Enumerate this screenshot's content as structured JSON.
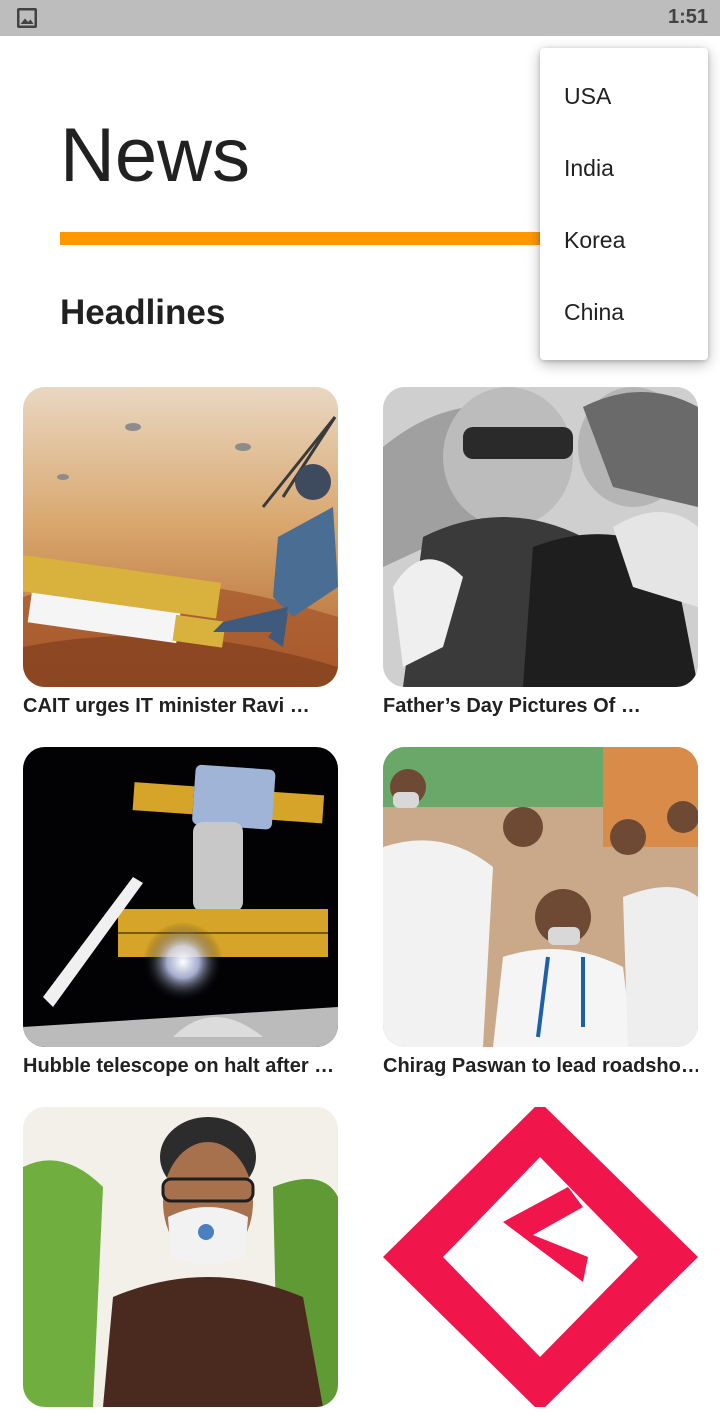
{
  "status_bar": {
    "time": "1:51",
    "notification_icon": "image-icon"
  },
  "header": {
    "title": "News",
    "underline_color": "#ff9800"
  },
  "section": {
    "title": "Headlines"
  },
  "cards": [
    {
      "caption": "CAIT urges IT minister Ravi …",
      "image": "battlegrounds-mobile-india-art"
    },
    {
      "caption": "Father’s Day Pictures Of …",
      "image": "black-and-white-family-photo"
    },
    {
      "caption": "Hubble telescope on halt after …",
      "image": "hubble-telescope-in-space"
    },
    {
      "caption": "Chirag Paswan to lead roadsho…",
      "image": "crowd-of-politicians"
    },
    {
      "caption": "",
      "image": "man-wearing-face-mask"
    },
    {
      "caption": "",
      "image": "red-logo"
    }
  ],
  "country_menu": {
    "items": [
      {
        "label": "USA"
      },
      {
        "label": "India"
      },
      {
        "label": "Korea"
      },
      {
        "label": "China"
      }
    ]
  }
}
